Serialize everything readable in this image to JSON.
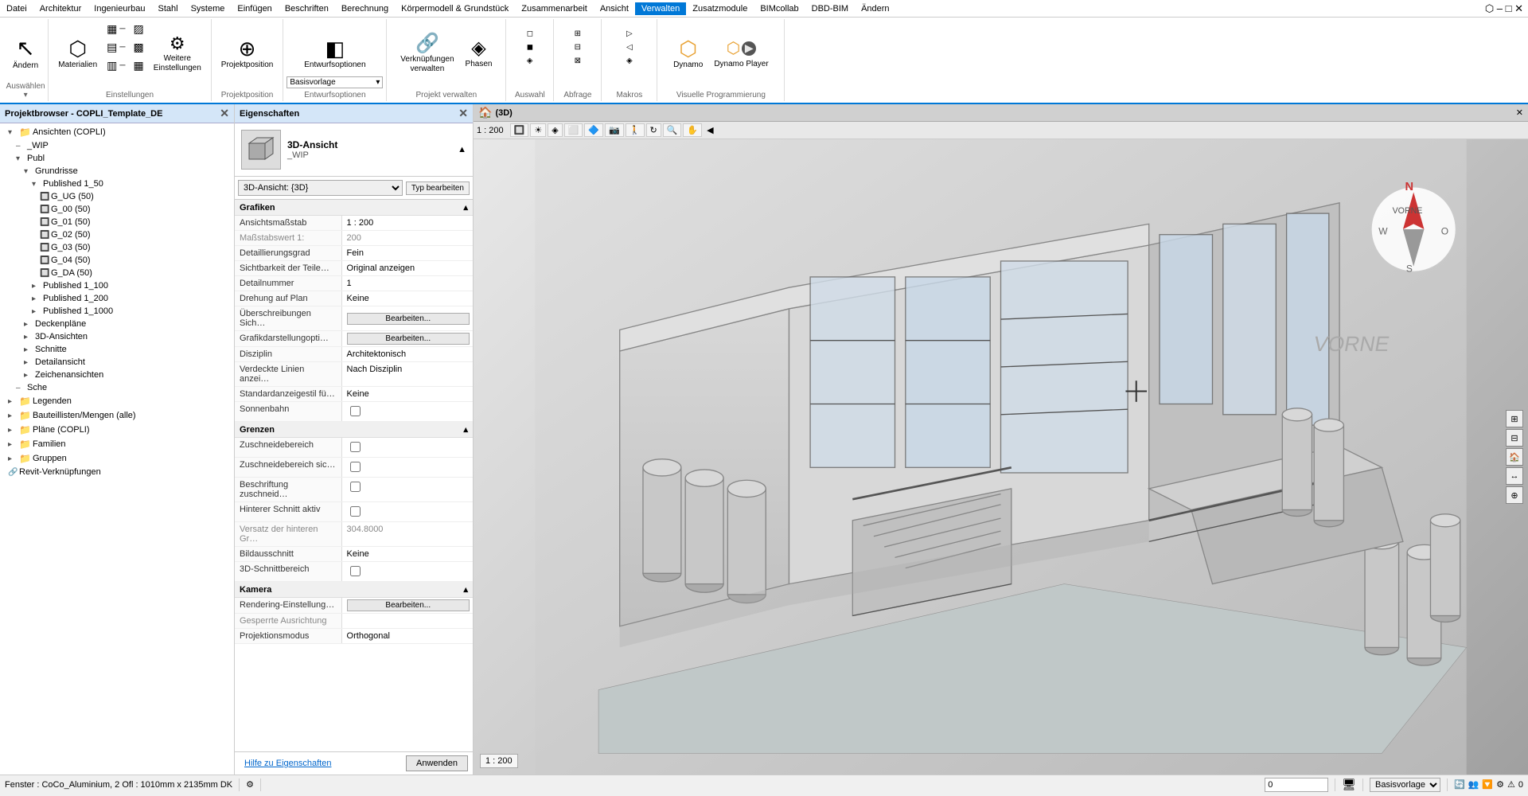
{
  "menubar": {
    "items": [
      "Datei",
      "Architektur",
      "Ingenieurbau",
      "Stahl",
      "Systeme",
      "Einfügen",
      "Beschriften",
      "Berechnung",
      "Körpermodell & Grundstück",
      "Zusammenarbeit",
      "Ansicht",
      "Verwalten",
      "Zusatzmodule",
      "BIMcollab",
      "DBD-BIM",
      "Ändern"
    ],
    "active_index": 11
  },
  "ribbon": {
    "groups": [
      {
        "label": "Auswählen",
        "buttons": [
          {
            "icon": "↖",
            "label": "Ändern"
          }
        ]
      },
      {
        "label": "Einstellungen",
        "buttons": [
          {
            "icon": "⬡",
            "label": "Materialien"
          },
          {
            "icon": "⚙",
            "label": "Weitere\nEinstellungen"
          }
        ]
      },
      {
        "label": "Projektposition",
        "buttons": [
          {
            "icon": "⊕",
            "label": "Projektposition"
          }
        ]
      },
      {
        "label": "Entwurfsoptionen",
        "buttons": [
          {
            "icon": "◧",
            "label": "Entwurfsoptionen"
          }
        ],
        "dropdown_label": "Basisvorlage"
      },
      {
        "label": "Projekt verwalten",
        "buttons": [
          {
            "icon": "🔗",
            "label": "Verknüpfungen\nverwalten"
          },
          {
            "icon": "◈",
            "label": "Phasen"
          }
        ]
      },
      {
        "label": "Auswahl",
        "buttons": []
      },
      {
        "label": "Abfrage",
        "buttons": []
      },
      {
        "label": "Makros",
        "buttons": []
      },
      {
        "label": "Visuelle Programmierung",
        "buttons": [
          {
            "icon": "⬡",
            "label": "Dynamo"
          },
          {
            "icon": "▶",
            "label": "Dynamo Player"
          }
        ]
      }
    ]
  },
  "project_browser": {
    "title": "Projektbrowser - COPLI_Template_DE",
    "tree": [
      {
        "indent": 1,
        "icon": "▾",
        "type": "folder",
        "label": "Ansichten (COPLI)"
      },
      {
        "indent": 2,
        "icon": "–",
        "type": "item",
        "label": "_WIP"
      },
      {
        "indent": 2,
        "icon": "▾",
        "type": "folder",
        "label": "Publ"
      },
      {
        "indent": 3,
        "icon": "▾",
        "type": "folder",
        "label": "Grundrisse"
      },
      {
        "indent": 4,
        "icon": "▾",
        "type": "folder",
        "label": "Published 1_50"
      },
      {
        "indent": 5,
        "icon": "–",
        "type": "item",
        "label": "G_UG (50)"
      },
      {
        "indent": 5,
        "icon": "–",
        "type": "item",
        "label": "G_00 (50)"
      },
      {
        "indent": 5,
        "icon": "–",
        "type": "item",
        "label": "G_01 (50)"
      },
      {
        "indent": 5,
        "icon": "–",
        "type": "item",
        "label": "G_02 (50)"
      },
      {
        "indent": 5,
        "icon": "–",
        "type": "item",
        "label": "G_03 (50)"
      },
      {
        "indent": 5,
        "icon": "–",
        "type": "item",
        "label": "G_04 (50)"
      },
      {
        "indent": 5,
        "icon": "–",
        "type": "item",
        "label": "G_DA (50)"
      },
      {
        "indent": 4,
        "icon": "▸",
        "type": "folder",
        "label": "Published 1_100"
      },
      {
        "indent": 4,
        "icon": "▸",
        "type": "folder",
        "label": "Published 1_200"
      },
      {
        "indent": 4,
        "icon": "▸",
        "type": "folder",
        "label": "Published 1_1000"
      },
      {
        "indent": 3,
        "icon": "▸",
        "type": "folder",
        "label": "Deckenpläne"
      },
      {
        "indent": 3,
        "icon": "▸",
        "type": "folder",
        "label": "3D-Ansichten"
      },
      {
        "indent": 3,
        "icon": "▸",
        "type": "folder",
        "label": "Schnitte"
      },
      {
        "indent": 3,
        "icon": "▸",
        "type": "folder",
        "label": "Detailansicht"
      },
      {
        "indent": 3,
        "icon": "▸",
        "type": "folder",
        "label": "Zeichenansichten"
      },
      {
        "indent": 2,
        "icon": "–",
        "type": "item",
        "label": "Sche"
      },
      {
        "indent": 1,
        "icon": "▸",
        "type": "folder",
        "label": "Legenden"
      },
      {
        "indent": 1,
        "icon": "▸",
        "type": "folder",
        "label": "Bauteillisten/Mengen (alle)"
      },
      {
        "indent": 1,
        "icon": "▸",
        "type": "folder",
        "label": "Pläne (COPLI)"
      },
      {
        "indent": 1,
        "icon": "▸",
        "type": "folder",
        "label": "Familien"
      },
      {
        "indent": 1,
        "icon": "▸",
        "type": "folder",
        "label": "Gruppen"
      },
      {
        "indent": 1,
        "icon": "🔗",
        "type": "item",
        "label": "Revit-Verknüpfungen"
      }
    ]
  },
  "properties": {
    "title": "Eigenschaften",
    "view_icon": "🏠",
    "view_name": "3D-Ansicht",
    "view_subname": "_WIP",
    "selector": "3D-Ansicht: {3D}",
    "type_edit_btn": "Typ bearbeiten",
    "sections": [
      {
        "name": "Grafiken",
        "rows": [
          {
            "key": "Ansichtsmaßstab",
            "val": "1 : 200",
            "editable": false
          },
          {
            "key": "Maßstabswert 1:",
            "val": "200",
            "editable": false,
            "gray": true
          },
          {
            "key": "Detaillierungsgrad",
            "val": "Fein",
            "editable": false
          },
          {
            "key": "Sichtbarkeit der Teile…",
            "val": "Original anzeigen",
            "editable": false
          },
          {
            "key": "Detailnummer",
            "val": "1",
            "editable": false
          },
          {
            "key": "Drehung auf Plan",
            "val": "Keine",
            "editable": false
          },
          {
            "key": "Überschreibungen Sich…",
            "val": "Bearbeiten...",
            "editable": true
          },
          {
            "key": "Grafikdarstellungopti…",
            "val": "Bearbeiten...",
            "editable": true
          },
          {
            "key": "Disziplin",
            "val": "Architektonisch",
            "editable": false
          },
          {
            "key": "Verdeckte Linien anzei…",
            "val": "Nach Disziplin",
            "editable": false
          },
          {
            "key": "Standardanzeigestil fü…",
            "val": "Keine",
            "editable": false
          },
          {
            "key": "Sonnenbahn",
            "val": "",
            "checkbox": true,
            "editable": false
          }
        ]
      },
      {
        "name": "Grenzen",
        "rows": [
          {
            "key": "Zuschneidebereich",
            "val": "",
            "checkbox": true,
            "editable": false
          },
          {
            "key": "Zuschneidebereich sic…",
            "val": "",
            "checkbox": true,
            "editable": false
          },
          {
            "key": "Beschriftung zuschneid…",
            "val": "",
            "checkbox": true,
            "editable": false
          },
          {
            "key": "Hinterer Schnitt aktiv",
            "val": "",
            "checkbox": false,
            "editable": false
          },
          {
            "key": "Versatz der hinteren Gr…",
            "val": "304.8000",
            "editable": false,
            "gray": true
          },
          {
            "key": "Bildausschnitt",
            "val": "Keine",
            "editable": false
          },
          {
            "key": "3D-Schnittbereich",
            "val": "",
            "checkbox": true,
            "editable": false
          }
        ]
      },
      {
        "name": "Kamera",
        "rows": [
          {
            "key": "Rendering-Einstellung…",
            "val": "Bearbeiten...",
            "editable": true
          },
          {
            "key": "Gesperrte Ausrichtung",
            "val": "",
            "editable": false,
            "gray": true
          },
          {
            "key": "Projektionsmodus",
            "val": "Orthogonal",
            "editable": false
          }
        ]
      }
    ],
    "help_link": "Hilfe zu Eigenschaften",
    "apply_btn": "Anwenden"
  },
  "view_3d": {
    "title": "(3D)",
    "scale": "1 : 200"
  },
  "bottom_toolbar": {
    "status_text": "Fenster : CoCo_Aluminium, 2 Ofl : 1010mm x 2135mm DK",
    "coordinate_label": "0",
    "template_dropdown": "Basisvorlage"
  }
}
